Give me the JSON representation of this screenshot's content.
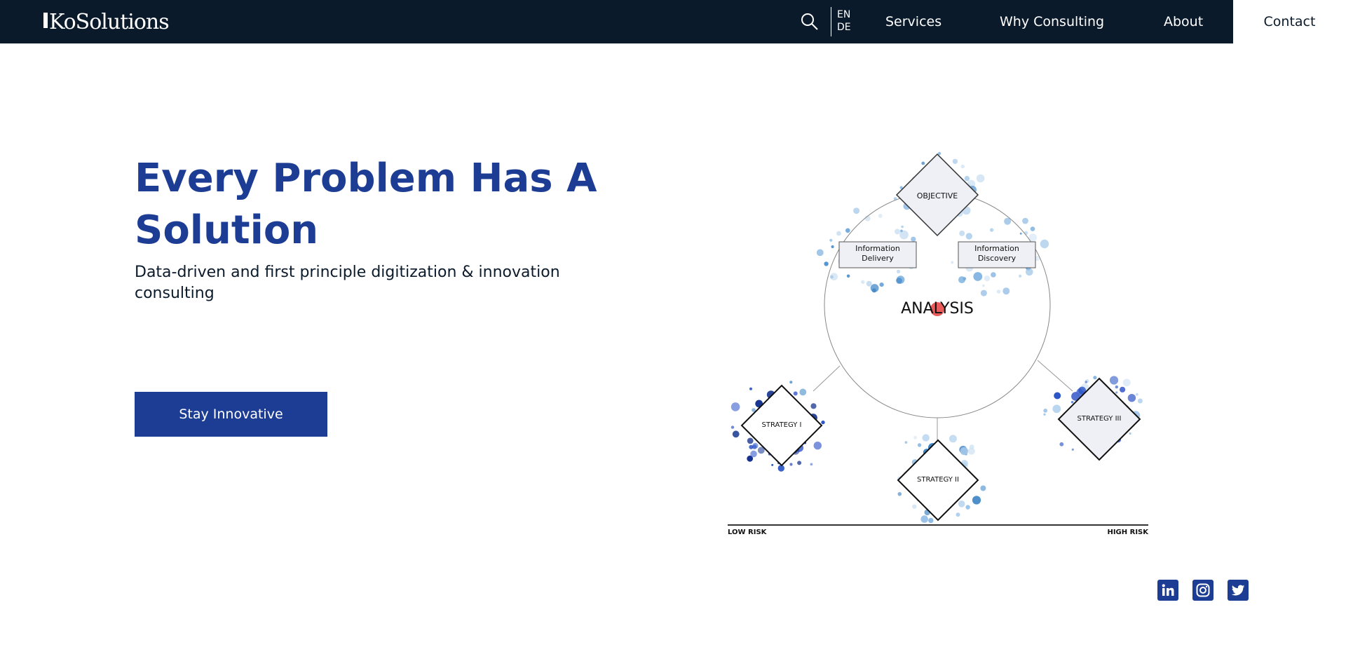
{
  "nav": {
    "logo_text": "KoSolutions",
    "lang_en": "EN",
    "lang_de": "DE",
    "services": "Services",
    "why": "Why Consulting",
    "about": "About",
    "contact": "Contact"
  },
  "hero": {
    "title": "Every Problem Has A Solution",
    "subtitle": "Data-driven and first principle digitization & innovation consulting",
    "cta": "Stay Innovative"
  },
  "diagram": {
    "objective": "OBJECTIVE",
    "info_delivery": "Information Delivery",
    "info_discovery": "Information Discovery",
    "analysis": "ANALYSIS",
    "strategy1": "STRATEGY I",
    "strategy2": "STRATEGY II",
    "strategy3": "STRATEGY III",
    "low_risk": "LOW RISK",
    "high_risk": "HIGH RISK"
  },
  "social": [
    "linkedin-icon",
    "instagram-icon",
    "twitter-icon"
  ],
  "colors": {
    "nav_bg": "#0a1a2a",
    "brand_blue": "#1d3d94",
    "analysis_dot": "#e84a4a"
  }
}
